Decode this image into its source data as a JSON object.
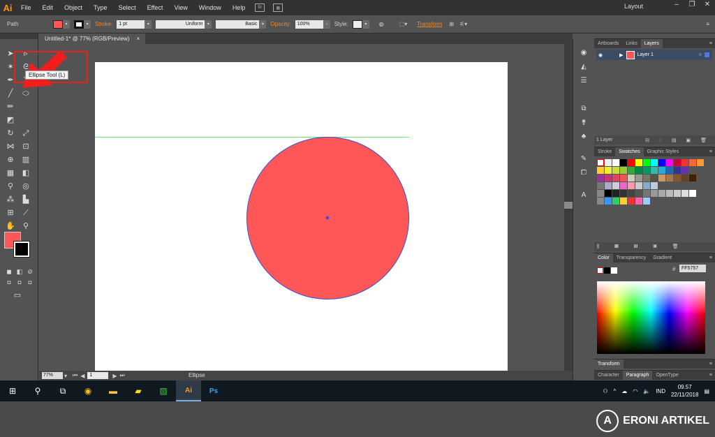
{
  "app": {
    "logo": "Ai",
    "workspace": "Layout"
  },
  "menu": [
    "File",
    "Edit",
    "Object",
    "Type",
    "Select",
    "Effect",
    "View",
    "Window",
    "Help"
  ],
  "window_controls": [
    "–",
    "❐",
    "✕"
  ],
  "controlbar": {
    "selection": "Path",
    "stroke_label": "Stroke:",
    "stroke_weight": "1 pt",
    "profile": "Uniform",
    "brush": "Basic",
    "opacity_label": "Opacity:",
    "opacity": "100%",
    "style_label": "Style:",
    "transform": "Transform",
    "fill_color": "#ff5757"
  },
  "document": {
    "tab": "Untitled-1* @ 77% (RGB/Preview)",
    "close": "×"
  },
  "tooltip": "Ellipse Tool (L)",
  "statusbar": {
    "zoom": "77%",
    "page": "1",
    "tool": "Ellipse"
  },
  "panels": {
    "layers": {
      "tabs": [
        "Artboards",
        "Links",
        "Layers"
      ],
      "layer_name": "Layer 1",
      "count": "1 Layer"
    },
    "swatches": {
      "tabs": [
        "Stroke",
        "Swatches",
        "Graphic Styles"
      ]
    },
    "color": {
      "tabs": [
        "Color",
        "Transparency",
        "Gradient"
      ],
      "hex_label": "#",
      "hex": "FF5757"
    },
    "transform": {
      "tabs": [
        "Transform"
      ]
    },
    "type": {
      "tabs": [
        "Character",
        "Paragraph",
        "OpenType"
      ]
    }
  },
  "taskbar": {
    "language": "IND",
    "time": "09.57",
    "date": "22/11/2018"
  },
  "watermark": {
    "logo": "A",
    "text": "ERONI ARTIKEL"
  }
}
